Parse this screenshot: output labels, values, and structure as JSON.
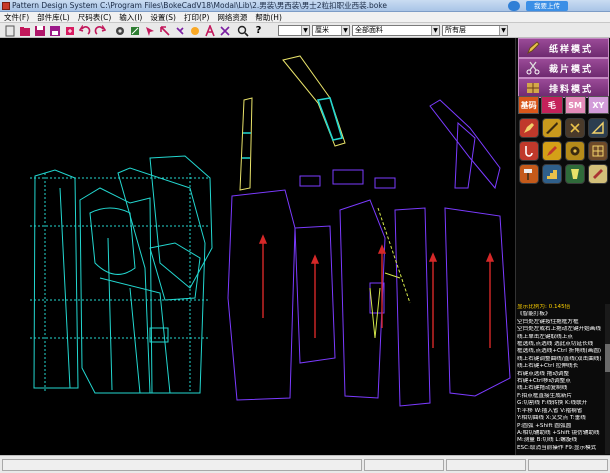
{
  "window": {
    "title": "Pattern Design System   C:\\Program Files\\BokeCadV18\\Modal\\Lib\\2.男装\\男西装\\男士2粒扣职业西装.boke",
    "cloud_button": "我要上传"
  },
  "menu": [
    "文件(F)",
    "部件库(L)",
    "尺码表(C)",
    "输入(I)",
    "设置(S)",
    "打印(P)",
    "网络资源",
    "帮助(H)"
  ],
  "toolbar": {
    "icons": [
      "new-icon",
      "open-icon",
      "save-icon",
      "save-as-icon",
      "export-icon",
      "undo-icon",
      "redo-icon",
      "gear-icon",
      "measure-icon",
      "arrow-icon",
      "text-icon",
      "cut-icon",
      "zoom-icon",
      "help-icon"
    ],
    "help_glyph": "?",
    "line_style_value": "",
    "unit_value": "厘米",
    "piece_value": "全部面料",
    "layer_value": "所有层"
  },
  "right_panel": {
    "modes": [
      {
        "label": "纸样模式",
        "icon": "pencil-icon"
      },
      {
        "label": "裁片模式",
        "icon": "scissors-icon"
      },
      {
        "label": "排料模式",
        "icon": "layout-icon"
      }
    ],
    "tabs": [
      {
        "label": "基码",
        "color": "#d9561a"
      },
      {
        "label": "毛",
        "color": "#c4215a"
      },
      {
        "label": "SM",
        "color": "#e38bb8"
      },
      {
        "label": "XY",
        "color": "#d29bd9"
      }
    ],
    "tools": [
      {
        "name": "pen-tool-icon",
        "bg": "#c0392b"
      },
      {
        "name": "ruler-tool-icon",
        "bg": "#c99a1d"
      },
      {
        "name": "scissor-tool-icon",
        "bg": "#4a3a2a"
      },
      {
        "name": "angle-tool-icon",
        "bg": "#2c3e50"
      },
      {
        "name": "hook-tool-icon",
        "bg": "#c0392b"
      },
      {
        "name": "pencil-tool-icon",
        "bg": "#d4a017"
      },
      {
        "name": "tape-tool-icon",
        "bg": "#b58b1a"
      },
      {
        "name": "grid-tool-icon",
        "bg": "#6e4a2a"
      },
      {
        "name": "hammer-tool-icon",
        "bg": "#c45a1a"
      },
      {
        "name": "stairs-tool-icon",
        "bg": "#2f5f8a"
      },
      {
        "name": "pattern-tool-icon",
        "bg": "#2f6a3a"
      },
      {
        "name": "chalk-tool-icon",
        "bg": "#d3c07a"
      }
    ],
    "ratio_text": "显示比例为: 0.145倍",
    "help_lines": [
      "《智能打板》",
      "空白处左键按住拖框方框",
      "空白处左或右上拖动左键开始画线",
      "线上单击左键取线上点",
      "框选线,点选线 选此点切延长线",
      "框选线,点选线+Ctrl 折角线(画圆)",
      "线上右键调整曲线/直线(双击曲线)",
      "线上右键+Ctrl 拉伸线长",
      "右键点选线 拖动调整",
      "右键+Ctrl移动调整点",
      "线上右键拖动复制线",
      "F:拍点框直接生成新片",
      "G:切割线  F:线转换  K:线联开",
      "T:平移  W:插入省  V:褶裥省",
      "Y:相切曲线  X:叉交点  T:垂线",
      "P:圆弧  +Shift 圆弧圆",
      "A:相切辅助线  +Shift 镜仿辅助线",
      "M:测量  B:切线  L:螺旋线",
      "ESC:取消当前操作  F9:显示模式"
    ]
  }
}
